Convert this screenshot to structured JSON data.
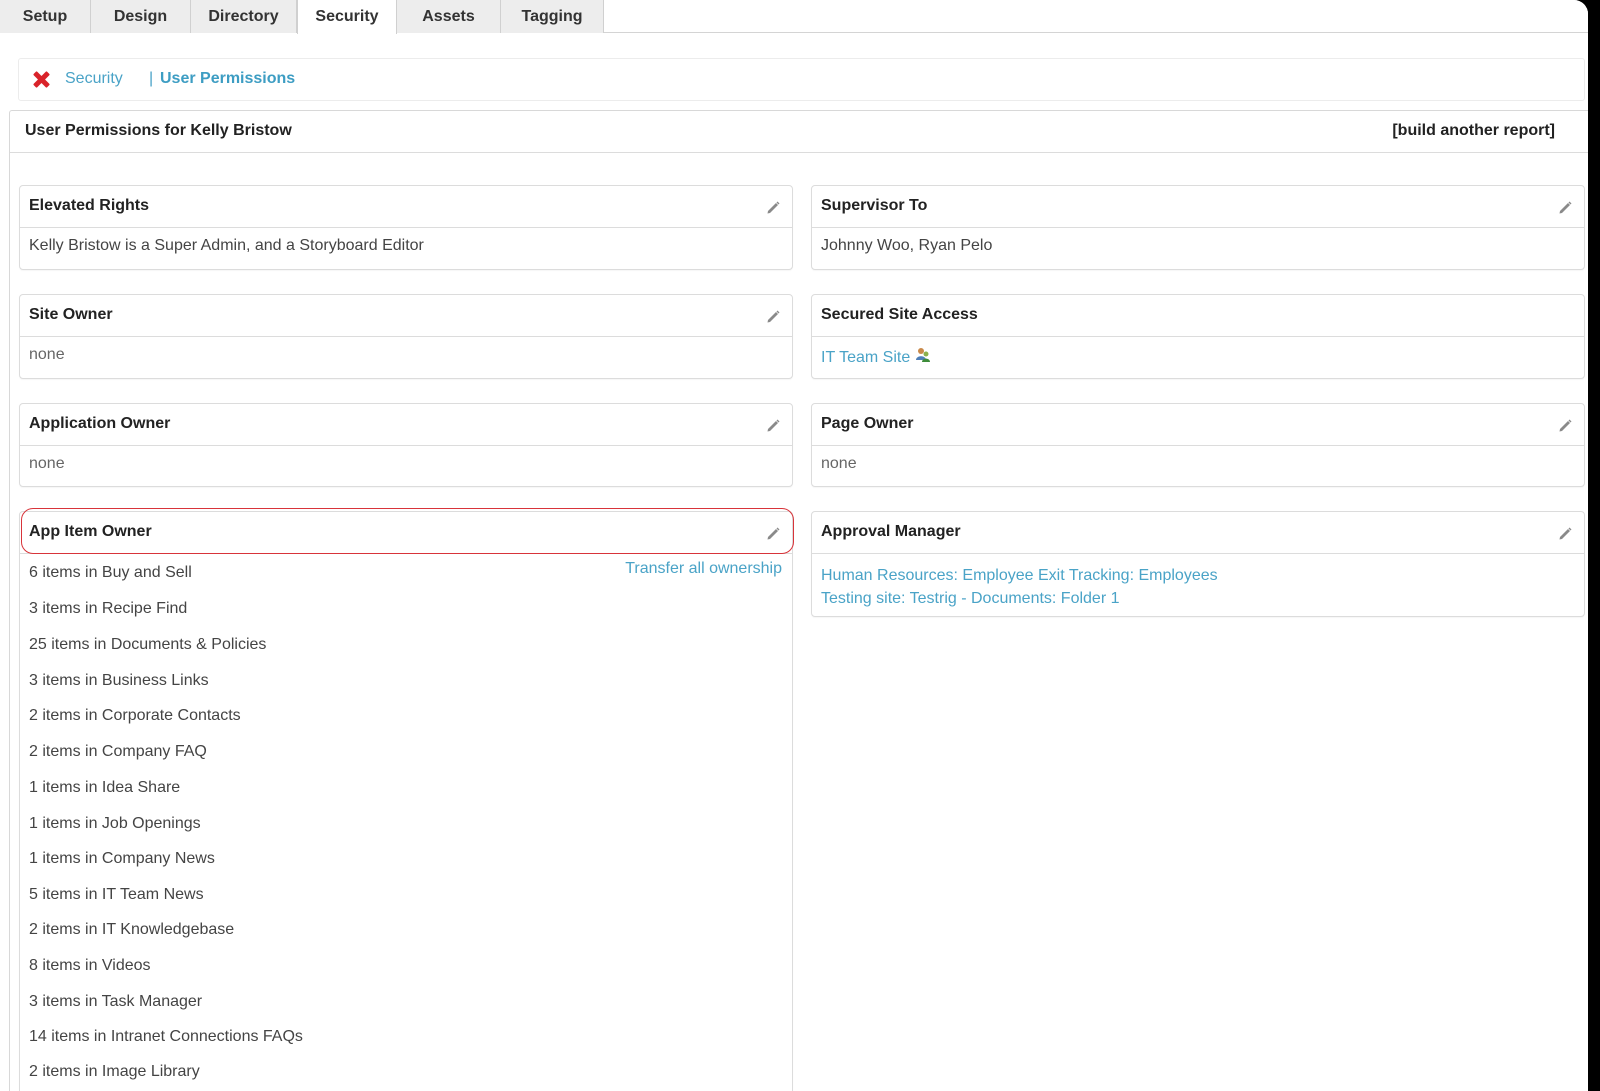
{
  "tabs": [
    {
      "label": "Setup",
      "active": false
    },
    {
      "label": "Design",
      "active": false
    },
    {
      "label": "Directory",
      "active": false
    },
    {
      "label": "Security",
      "active": true
    },
    {
      "label": "Assets",
      "active": false
    },
    {
      "label": "Tagging",
      "active": false
    }
  ],
  "breadcrumb": {
    "parent": "Security",
    "separator": "|",
    "current": "User Permissions"
  },
  "report": {
    "title": "User Permissions for Kelly Bristow",
    "build_link": "[build another report]"
  },
  "panels": {
    "elevated_rights": {
      "title": "Elevated Rights",
      "body": "Kelly Bristow is a Super Admin, and a Storyboard Editor"
    },
    "supervisor_to": {
      "title": "Supervisor To",
      "body": "Johnny Woo, Ryan Pelo"
    },
    "site_owner": {
      "title": "Site Owner",
      "body": "none"
    },
    "secured_site_access": {
      "title": "Secured Site Access",
      "body": "IT Team Site"
    },
    "application_owner": {
      "title": "Application Owner",
      "body": "none"
    },
    "page_owner": {
      "title": "Page Owner",
      "body": "none"
    },
    "app_item_owner": {
      "title": "App Item Owner",
      "transfer_link": "Transfer all ownership",
      "items": [
        "6 items in Buy and Sell",
        "3 items in Recipe Find",
        "25 items in Documents & Policies",
        "3 items in Business Links",
        "2 items in Corporate Contacts",
        "2 items in Company FAQ",
        "1 items in Idea Share",
        "1 items in Job Openings",
        "1 items in Company News",
        "5 items in IT Team News",
        "2 items in IT Knowledgebase",
        "8 items in Videos",
        "3 items in Task Manager",
        "14 items in Intranet Connections FAQs",
        "2 items in Image Library"
      ]
    },
    "approval_manager": {
      "title": "Approval Manager",
      "links": [
        "Human Resources: Employee Exit Tracking: Employees",
        "Testing site: Testrig - Documents: Folder 1"
      ]
    }
  },
  "icons": {
    "close": "close-icon",
    "edit": "pencil-icon",
    "group": "user-group-icon"
  },
  "colors": {
    "link": "#4aa3c7",
    "close_red": "#d9232a",
    "highlight_red": "#d8343a"
  }
}
